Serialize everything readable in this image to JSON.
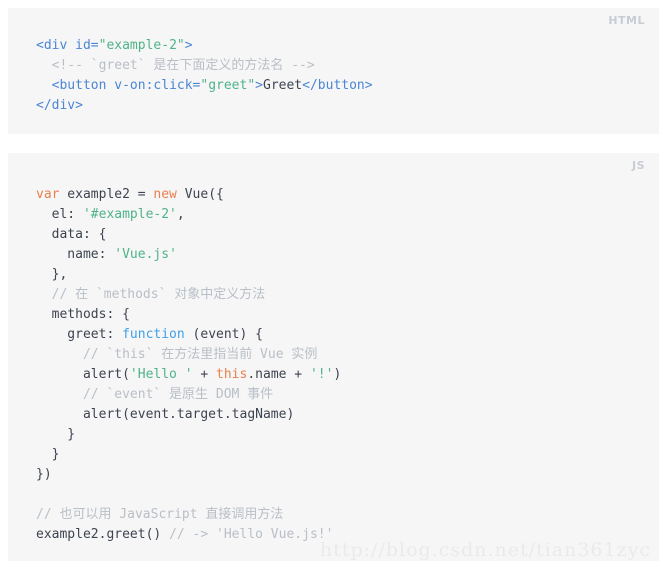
{
  "page": {
    "background_color": "#ffffff",
    "code_block_background": "#f6f6f6"
  },
  "colors": {
    "tag": "#4a86d4",
    "string": "#4eb389",
    "comment": "#b9bfc7",
    "keyword": "#e8804f",
    "function": "#3fa0e8",
    "plain_text": "#3d4450",
    "lang_label": "#c8ccd4",
    "watermark": "#eaeaea"
  },
  "blocks": [
    {
      "id": "html-block",
      "lang_label": "HTML",
      "lines": [
        [
          {
            "t": "<div ",
            "c": "tag"
          },
          {
            "t": "id=",
            "c": "attr"
          },
          {
            "t": "\"example-2\"",
            "c": "string"
          },
          {
            "t": ">",
            "c": "tag"
          }
        ],
        [
          {
            "t": "  <!-- `greet` 是在下面定义的方法名 -->",
            "c": "comment"
          }
        ],
        [
          {
            "t": "  <button ",
            "c": "tag"
          },
          {
            "t": "v-on:click=",
            "c": "attr"
          },
          {
            "t": "\"greet\"",
            "c": "string"
          },
          {
            "t": ">",
            "c": "tag"
          },
          {
            "t": "Greet",
            "c": "text"
          },
          {
            "t": "</button>",
            "c": "tag"
          }
        ],
        [
          {
            "t": "</div>",
            "c": "tag"
          }
        ]
      ]
    },
    {
      "id": "js-block",
      "lang_label": "JS",
      "lines": [
        [
          {
            "t": "var",
            "c": "keyword"
          },
          {
            "t": " example2 = ",
            "c": "plain"
          },
          {
            "t": "new",
            "c": "keyword"
          },
          {
            "t": " Vue({",
            "c": "plain"
          }
        ],
        [
          {
            "t": "  el: ",
            "c": "plain"
          },
          {
            "t": "'#example-2'",
            "c": "string"
          },
          {
            "t": ",",
            "c": "plain"
          }
        ],
        [
          {
            "t": "  data: {",
            "c": "plain"
          }
        ],
        [
          {
            "t": "    name: ",
            "c": "plain"
          },
          {
            "t": "'Vue.js'",
            "c": "string"
          }
        ],
        [
          {
            "t": "  },",
            "c": "plain"
          }
        ],
        [
          {
            "t": "  // 在 `methods` 对象中定义方法",
            "c": "comment"
          }
        ],
        [
          {
            "t": "  methods: {",
            "c": "plain"
          }
        ],
        [
          {
            "t": "    greet: ",
            "c": "plain"
          },
          {
            "t": "function",
            "c": "fn"
          },
          {
            "t": " (event) {",
            "c": "plain"
          }
        ],
        [
          {
            "t": "      // `this` 在方法里指当前 Vue 实例",
            "c": "comment"
          }
        ],
        [
          {
            "t": "      alert(",
            "c": "plain"
          },
          {
            "t": "'Hello '",
            "c": "string"
          },
          {
            "t": " + ",
            "c": "plain"
          },
          {
            "t": "this",
            "c": "keyword"
          },
          {
            "t": ".name + ",
            "c": "plain"
          },
          {
            "t": "'!'",
            "c": "string"
          },
          {
            "t": ")",
            "c": "plain"
          }
        ],
        [
          {
            "t": "      // `event` 是原生 DOM 事件",
            "c": "comment"
          }
        ],
        [
          {
            "t": "      alert(event.target.tagName)",
            "c": "plain"
          }
        ],
        [
          {
            "t": "    }",
            "c": "plain"
          }
        ],
        [
          {
            "t": "  }",
            "c": "plain"
          }
        ],
        [
          {
            "t": "})",
            "c": "plain"
          }
        ],
        [
          {
            "t": "",
            "c": "plain"
          }
        ],
        [
          {
            "t": "// 也可以用 JavaScript 直接调用方法",
            "c": "comment"
          }
        ],
        [
          {
            "t": "example2.greet() ",
            "c": "plain"
          },
          {
            "t": "// -> 'Hello Vue.js!'",
            "c": "comment"
          }
        ]
      ]
    }
  ],
  "watermark": {
    "text": "http://blog.csdn.net/tian361zyc"
  }
}
